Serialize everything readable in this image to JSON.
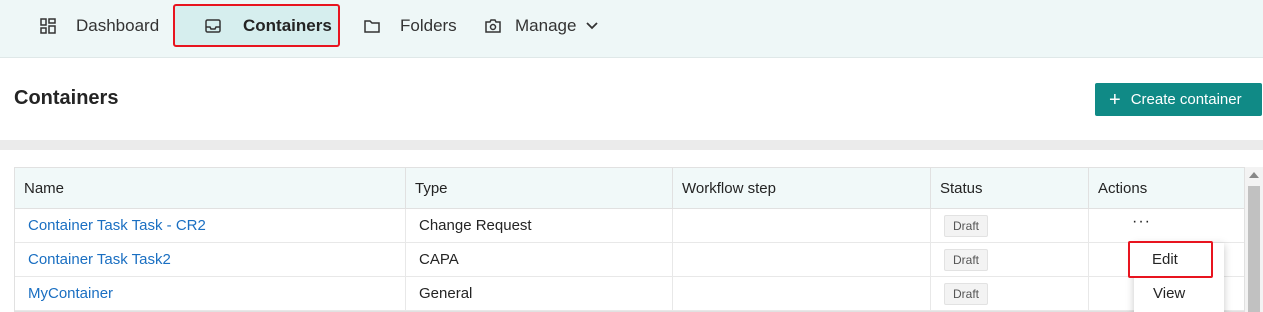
{
  "nav": {
    "items": [
      {
        "label": "Dashboard",
        "icon": "dashboard-icon"
      },
      {
        "label": "Containers",
        "icon": "inbox-icon",
        "active": true
      },
      {
        "label": "Folders",
        "icon": "folder-icon"
      },
      {
        "label": "Manage",
        "icon": "manage-icon"
      }
    ]
  },
  "page": {
    "title": "Containers",
    "create_label": "Create container"
  },
  "table": {
    "columns": [
      "Name",
      "Type",
      "Workflow step",
      "Status",
      "Actions"
    ],
    "rows": [
      {
        "name": "Container Task Task - CR2",
        "type": "Change Request",
        "workflow": "",
        "status": "Draft"
      },
      {
        "name": "Container Task Task2",
        "type": "CAPA",
        "workflow": "",
        "status": "Draft"
      },
      {
        "name": "MyContainer",
        "type": "General",
        "workflow": "",
        "status": "Draft"
      }
    ],
    "more_label": "···"
  },
  "menu": {
    "edit_label": "Edit",
    "view_label": "View"
  },
  "colors": {
    "accent": "#108a86",
    "highlight": "#e8141f",
    "link": "#1a6fc2"
  }
}
